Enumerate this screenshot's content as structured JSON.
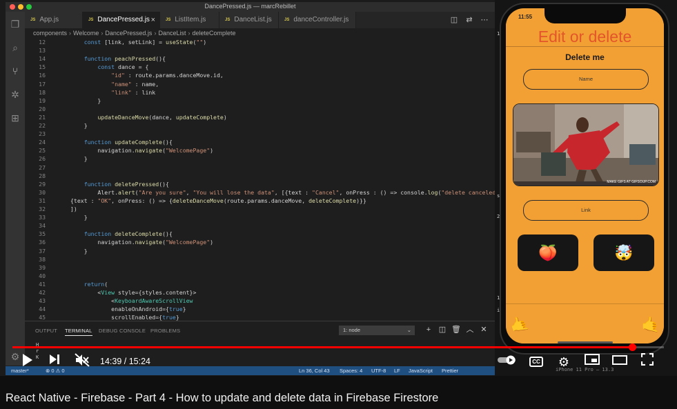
{
  "vscode": {
    "window_title": "DancePressed.js — marcRebillet",
    "tabs": [
      {
        "label": "App.js",
        "active": false
      },
      {
        "label": "DancePressed.js",
        "active": true
      },
      {
        "label": "ListItem.js",
        "active": false
      },
      {
        "label": "DanceList.js",
        "active": false
      },
      {
        "label": "danceController.js",
        "active": false
      }
    ],
    "tab_badge": "JS",
    "breadcrumb": [
      "components",
      "Welcome",
      "DancePressed.js",
      "DanceList",
      "deleteComplete"
    ],
    "code_lines": [
      {
        "n": "12",
        "text": "    const [link, setLink] = useState(\"\")"
      },
      {
        "n": "13",
        "text": ""
      },
      {
        "n": "14",
        "text": "    function peachPressed(){"
      },
      {
        "n": "15",
        "text": "        const dance = {"
      },
      {
        "n": "16",
        "text": "            \"id\" : route.params.danceMove.id,"
      },
      {
        "n": "17",
        "text": "            \"name\" : name,"
      },
      {
        "n": "18",
        "text": "            \"link\" : link"
      },
      {
        "n": "19",
        "text": "        }"
      },
      {
        "n": "20",
        "text": ""
      },
      {
        "n": "21",
        "text": "        updateDanceMove(dance, updateComplete)"
      },
      {
        "n": "22",
        "text": "    }"
      },
      {
        "n": "23",
        "text": ""
      },
      {
        "n": "24",
        "text": "    function updateComplete(){"
      },
      {
        "n": "25",
        "text": "        navigation.navigate(\"WelcomePage\")"
      },
      {
        "n": "26",
        "text": "    }"
      },
      {
        "n": "27",
        "text": ""
      },
      {
        "n": "28",
        "text": ""
      },
      {
        "n": "29",
        "text": "    function deletePressed(){"
      },
      {
        "n": "30",
        "text": "        Alert.alert(\"Are you sure\", \"You will lose the data\", [{text : \"Cancel\", onPress : () => console.log(\"delete canceled\")},"
      },
      {
        "n": "31",
        "text": "{text : \"OK\", onPress: () => {deleteDanceMove(route.params.danceMove, deleteComplete)}}"
      },
      {
        "n": "32",
        "text": "])"
      },
      {
        "n": "33",
        "text": "    }"
      },
      {
        "n": "34",
        "text": ""
      },
      {
        "n": "35",
        "text": "    function deleteComplete(){"
      },
      {
        "n": "36",
        "text": "        navigation.navigate(\"WelcomePage\")"
      },
      {
        "n": "37",
        "text": "    }"
      },
      {
        "n": "38",
        "text": ""
      },
      {
        "n": "39",
        "text": ""
      },
      {
        "n": "40",
        "text": ""
      },
      {
        "n": "41",
        "text": "    return("
      },
      {
        "n": "42",
        "text": "        <View style={styles.content}>"
      },
      {
        "n": "43",
        "text": "            <KeyboardAwareScrollView"
      },
      {
        "n": "44",
        "text": "            enableOnAndroid={true}"
      },
      {
        "n": "45",
        "text": "            scrollEnabled={true}"
      }
    ],
    "panel_tabs": [
      {
        "label": "OUTPUT",
        "active": false
      },
      {
        "label": "TERMINAL",
        "active": true
      },
      {
        "label": "DEBUG CONSOLE",
        "active": false
      },
      {
        "label": "PROBLEMS",
        "active": false
      }
    ],
    "terminal_select": "1: node",
    "terminal_lines": [
      "H",
      "r",
      "K"
    ],
    "status_left": [
      "master*",
      "⊗ 0 ⚠ 0"
    ],
    "status_right": [
      "Ln 36, Col 43",
      "Spaces: 4",
      "UTF-8",
      "LF",
      "JavaScript",
      "Prettier"
    ]
  },
  "simulator": {
    "status_time": "11:55",
    "header_title": "Edit or delete",
    "content_title": "Delete me",
    "name_placeholder": "Name",
    "link_placeholder": "Link",
    "gif_caption": "MAKE GIFS AT GIFSOUP.COM",
    "peach_button": "🍑",
    "delete_button": "🤯",
    "nav_left": "🤙",
    "nav_right": "🤙",
    "device_label": "iPhone 11 Pro — 13.3",
    "bg_text": [
      "1",
      "ss",
      "20",
      "19",
      "ie"
    ]
  },
  "player": {
    "time_current": "14:39",
    "time_total": "15:24",
    "time_separator": " / ",
    "progress": 0.9513,
    "autoplay_on": true,
    "cc_label": "CC",
    "accent_color": "#ff0000"
  },
  "video_title": "React Native - Firebase - Part 4 - How to update and delete data in Firebase Firestore",
  "colors": {
    "app_orange": "#f2a033",
    "app_title": "#e3552a",
    "statusbar": "#1f4e80"
  }
}
